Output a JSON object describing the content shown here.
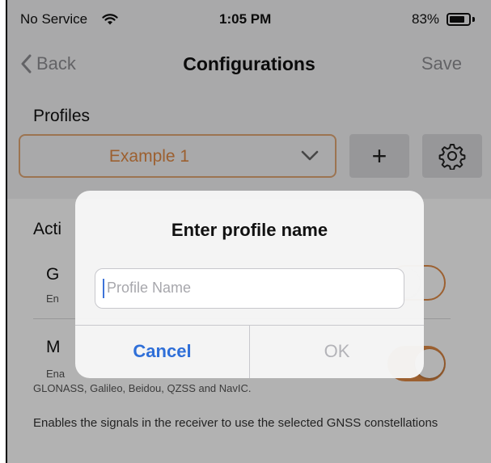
{
  "status_bar": {
    "carrier": "No Service",
    "time": "1:05 PM",
    "battery_percent": "83%",
    "battery_level": 0.83
  },
  "nav_bar": {
    "back_label": "Back",
    "title": "Configurations",
    "save_label": "Save"
  },
  "profiles": {
    "label": "Profiles",
    "selected": "Example 1",
    "add_symbol": "+"
  },
  "content": {
    "active_label": "Acti",
    "rows": [
      {
        "title": "G",
        "subtitle": "En"
      },
      {
        "title": "M",
        "subtitle": "Ena",
        "subtitle2": "GLONASS, Galileo, Beidou, QZSS and NavIC."
      }
    ],
    "footer_note": "Enables the signals in the receiver to use the selected GNSS constellations"
  },
  "alert": {
    "title": "Enter profile name",
    "input_placeholder": "Profile Name",
    "cancel_label": "Cancel",
    "ok_label": "OK"
  },
  "colors": {
    "accent": "#e08a45",
    "link_blue": "#2f6fd8",
    "disabled_gray": "#b3b3b8"
  },
  "icons": [
    "wifi-icon",
    "battery-icon",
    "chevron-left-icon",
    "chevron-down-icon",
    "gear-icon"
  ]
}
